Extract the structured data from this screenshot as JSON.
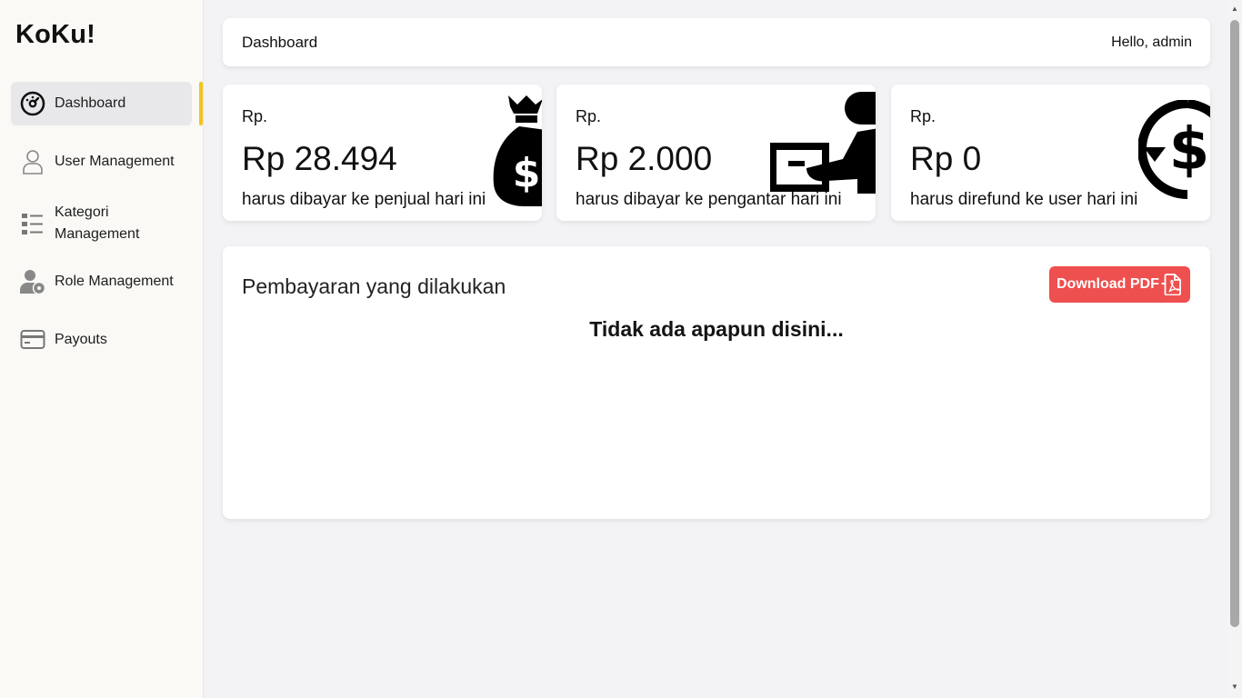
{
  "app": {
    "brand": "KoKu!"
  },
  "sidebar": {
    "items": [
      {
        "label": "Dashboard",
        "icon": "speedometer-icon"
      },
      {
        "label": "User Management",
        "icon": "user-icon"
      },
      {
        "label": "Kategori Management",
        "icon": "list-icon"
      },
      {
        "label": "Role Management",
        "icon": "user-cog-icon"
      },
      {
        "label": "Payouts",
        "icon": "credit-card-icon"
      }
    ]
  },
  "header": {
    "title": "Dashboard",
    "greeting": "Hello, admin"
  },
  "cards": [
    {
      "currency": "Rp.",
      "amount": "Rp 28.494",
      "description": "harus dibayar ke penjual hari ini",
      "icon": "money-bag-icon"
    },
    {
      "currency": "Rp.",
      "amount": "Rp 2.000",
      "description": "harus dibayar ke pengantar hari ini",
      "icon": "courier-package-icon"
    },
    {
      "currency": "Rp.",
      "amount": "Rp 0",
      "description": "harus direfund ke user hari ini",
      "icon": "refund-dollar-icon"
    }
  ],
  "payments": {
    "title": "Pembayaran yang dilakukan",
    "download_label": "Download PDF",
    "empty_text": "Tidak ada apapun disini..."
  },
  "colors": {
    "accent": "#f2c41a",
    "button": "#ee4f4f"
  }
}
